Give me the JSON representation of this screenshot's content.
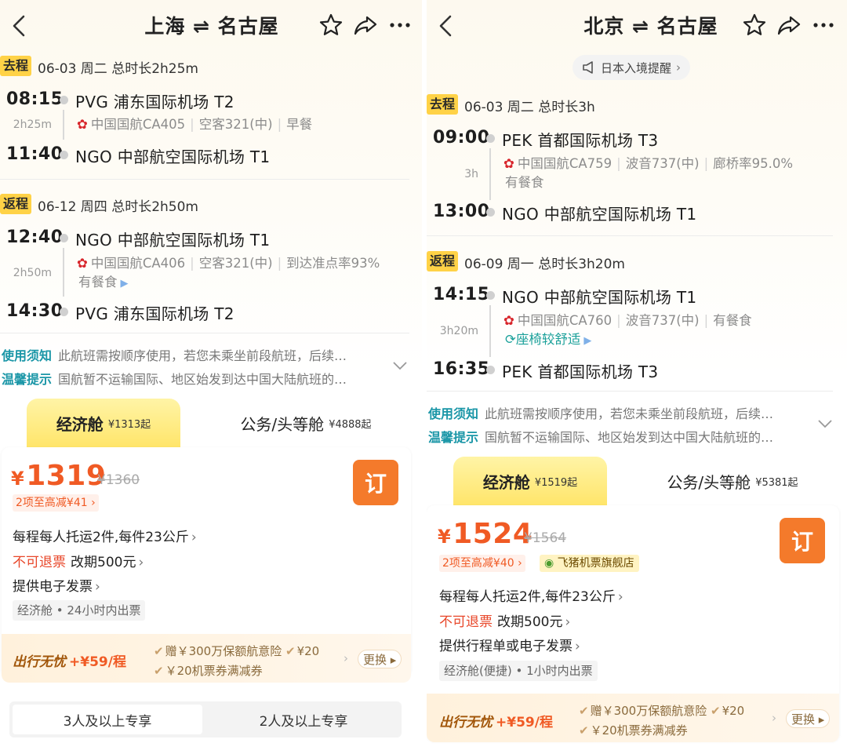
{
  "left": {
    "title": "上海 ⇌ 名古屋",
    "outbound": {
      "tag": "去程",
      "head": "06-03  周二  总时长2h25m",
      "dep_time": "08:15",
      "dep_airport": "PVG 浦东国际机场 T2",
      "duration": "2h25m",
      "airline": "中国国航CA405",
      "aircraft": "空客321(中)",
      "extra": "早餐",
      "arr_time": "11:40",
      "arr_airport": "NGO 中部航空国际机场 T1"
    },
    "return": {
      "tag": "返程",
      "head": "06-12  周四  总时长2h50m",
      "dep_time": "12:40",
      "dep_airport": "NGO 中部航空国际机场 T1",
      "duration": "2h50m",
      "airline": "中国国航CA406",
      "aircraft": "空客321(中)",
      "extra": "到达准点率93%",
      "extra2": "有餐食",
      "arr_time": "14:30",
      "arr_airport": "PVG 浦东国际机场 T2"
    },
    "tips": {
      "usage_label": "使用须知",
      "usage_text": "此航班需按顺序使用，若您未乘坐前段航班，后续…",
      "warm_label": "温馨提示",
      "warm_text": "国航暂不运输国际、地区始发到达中国大陆航班的…"
    },
    "cabins": {
      "economy": "经济舱",
      "economy_price": "¥1313起",
      "business": "公务/头等舱",
      "business_price": "¥4888起"
    },
    "offer": {
      "price": "1319",
      "yen": "¥",
      "old_price": "¥1360",
      "promo": "2项至高减¥41",
      "book": "订",
      "baggage": "每程每人托运2件,每件23公斤",
      "refund": "不可退票",
      "change": "改期500元",
      "invoice": "提供电子发票",
      "chip": "经济舱 • 24小时内出票"
    },
    "insurance": {
      "title": "出行无忧",
      "price": "+¥59/程",
      "item1": "赠￥300万保额航意险",
      "item1_more": "¥20",
      "item2": "￥20机票券满减券",
      "swap": "更换"
    },
    "groups": {
      "tab1": "3人及以上专享",
      "tab2": "2人及以上专享"
    }
  },
  "right": {
    "title": "北京 ⇌ 名古屋",
    "notice": "日本入境提醒",
    "outbound": {
      "tag": "去程",
      "head": "06-03  周二  总时长3h",
      "dep_time": "09:00",
      "dep_airport": "PEK 首都国际机场 T3",
      "duration": "3h",
      "airline": "中国国航CA759",
      "aircraft": "波音737(中)",
      "extra": "廊桥率95.0%",
      "extra2": "有餐食",
      "arr_time": "13:00",
      "arr_airport": "NGO 中部航空国际机场 T1"
    },
    "return": {
      "tag": "返程",
      "head": "06-09  周一  总时长3h20m",
      "dep_time": "14:15",
      "dep_airport": "NGO 中部航空国际机场 T1",
      "duration": "3h20m",
      "airline": "中国国航CA760",
      "aircraft": "波音737(中)",
      "extra": "有餐食",
      "comfort": "座椅较舒适",
      "arr_time": "16:35",
      "arr_airport": "PEK 首都国际机场 T3"
    },
    "tips": {
      "usage_label": "使用须知",
      "usage_text": "此航班需按顺序使用，若您未乘坐前段航班，后续…",
      "warm_label": "温馨提示",
      "warm_text": "国航暂不运输国际、地区始发到达中国大陆航班的…"
    },
    "cabins": {
      "economy": "经济舱",
      "economy_price": "¥1519起",
      "business": "公务/头等舱",
      "business_price": "¥5381起"
    },
    "offer": {
      "price": "1524",
      "yen": "¥",
      "old_price": "¥1564",
      "promo": "2项至高减¥40",
      "store": "飞猪机票旗舰店",
      "book": "订",
      "baggage": "每程每人托运2件,每件23公斤",
      "refund": "不可退票",
      "change": "改期500元",
      "invoice": "提供行程单或电子发票",
      "chip": "经济舱(便捷) • 1小时内出票"
    },
    "insurance": {
      "title": "出行无忧",
      "price": "+¥59/程",
      "item1": "赠￥300万保额航意险",
      "item1_more": "¥20",
      "item2": "￥20机票券满减券",
      "swap": "更换"
    }
  },
  "colors": {
    "accent_orange": "#f47a2b",
    "price_red": "#f05a24",
    "tag_yellow": "#ffd247",
    "tip_teal": "#1a96a7"
  }
}
